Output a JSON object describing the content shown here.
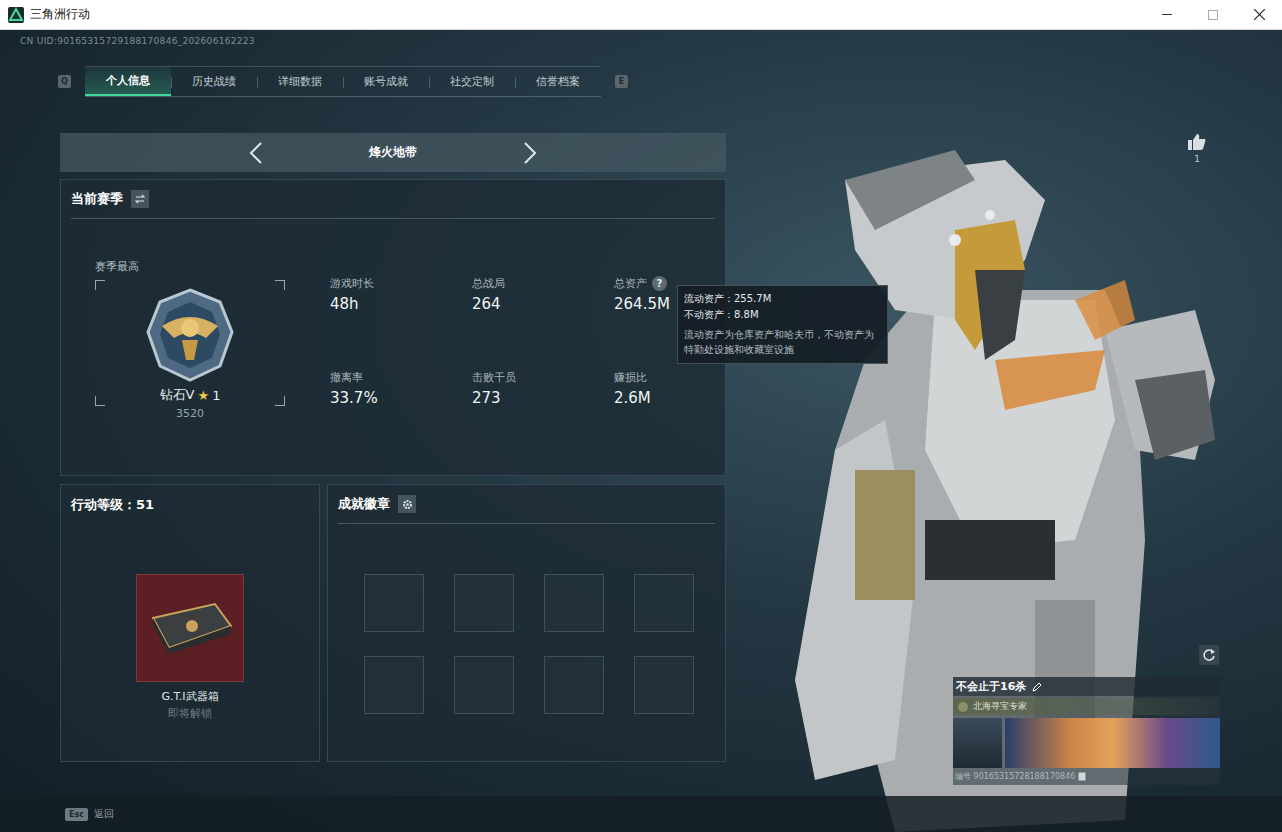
{
  "window": {
    "title": "三角洲行动"
  },
  "uid": "CN UID:90165315729188170846_202606162223",
  "tabs": {
    "prev_key": "Q",
    "next_key": "E",
    "items": [
      {
        "label": "个人信息",
        "selected": true
      },
      {
        "label": "历史战绩",
        "selected": false
      },
      {
        "label": "详细数据",
        "selected": false
      },
      {
        "label": "账号成就",
        "selected": false
      },
      {
        "label": "社交定制",
        "selected": false
      },
      {
        "label": "信誉档案",
        "selected": false
      }
    ]
  },
  "mode": {
    "label": "烽火地带"
  },
  "season": {
    "title": "当前赛季",
    "best_label": "赛季最高",
    "rank": "钻石V",
    "star": "★",
    "star_count": "1",
    "score": "3520",
    "help_icon": "?",
    "stats": [
      {
        "label": "游戏时长",
        "value": "48h",
        "help": false
      },
      {
        "label": "总战局",
        "value": "264",
        "help": false
      },
      {
        "label": "总资产",
        "value": "264.5M",
        "help": true
      },
      {
        "label": "撤离率",
        "value": "33.7%",
        "help": false
      },
      {
        "label": "击败干员",
        "value": "273",
        "help": false
      },
      {
        "label": "赚损比",
        "value": "2.6M",
        "help": false
      }
    ]
  },
  "tooltip": {
    "lines": [
      "流动资产：255.7M",
      "不动资产：8.8M"
    ],
    "note": "流动资产为仓库资产和哈夫币，不动资产为特勤处设施和收藏室设施"
  },
  "level": {
    "title": "行动等级：51",
    "reward": "G.T.I武器箱",
    "reward_status": "即将解锁"
  },
  "achievements": {
    "title": "成就徽章",
    "slots": [
      {
        "filled": false
      },
      {
        "filled": false
      },
      {
        "filled": false
      },
      {
        "filled": false
      },
      {
        "filled": false
      },
      {
        "filled": false
      },
      {
        "filled": false
      },
      {
        "filled": false
      }
    ]
  },
  "likes": {
    "count": "1"
  },
  "player_card": {
    "name": "不会止于16杀",
    "title": "北海寻宝专家",
    "id": "编号 90165315728188170846"
  },
  "footer": {
    "key": "Esc",
    "label": "返回"
  }
}
